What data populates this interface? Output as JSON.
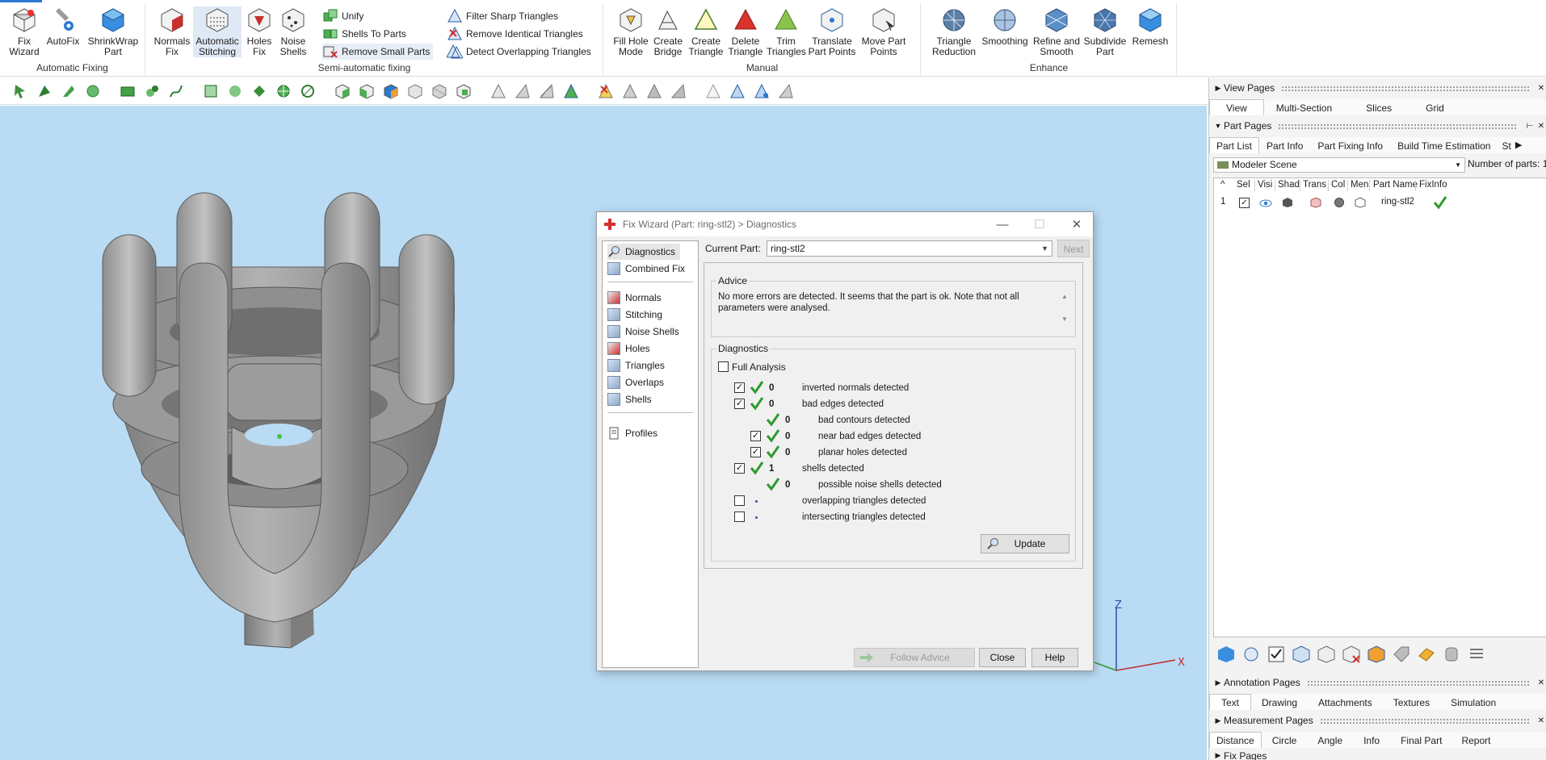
{
  "ribbon": {
    "groups": {
      "automatic": "Automatic Fixing",
      "semi": "Semi-automatic fixing",
      "manual": "Manual",
      "enhance": "Enhance"
    },
    "buttons": {
      "fix_wizard": "Fix Wizard",
      "autofix": "AutoFix",
      "shrinkwrap": "ShrinkWrap Part",
      "normals_fix": "Normals Fix",
      "auto_stitching": "Automatic Stitching",
      "holes_fix": "Holes Fix",
      "noise_shells": "Noise Shells",
      "unify": "Unify",
      "shells_to_parts": "Shells To Parts",
      "remove_small_parts": "Remove Small Parts",
      "filter_sharp": "Filter Sharp Triangles",
      "remove_identical": "Remove Identical Triangles",
      "detect_overlapping": "Detect Overlapping Triangles",
      "fill_hole_mode": "Fill Hole Mode",
      "create_bridge": "Create Bridge",
      "create_triangle": "Create Triangle",
      "delete_triangle": "Delete Triangle",
      "trim_triangles": "Trim Triangles",
      "translate_part_points": "Translate Part Points",
      "move_part_points": "Move Part Points",
      "triangle_reduction": "Triangle Reduction",
      "smoothing": "Smoothing",
      "refine_smooth": "Refine and Smooth",
      "subdivide_part": "Subdivide Part",
      "remesh": "Remesh"
    }
  },
  "axes": {
    "z": "Z",
    "x": "X"
  },
  "dialog": {
    "title": "Fix Wizard (Part: ring-stl2) > Diagnostics",
    "nav": {
      "diagnostics": "Diagnostics",
      "combined_fix": "Combined Fix",
      "normals": "Normals",
      "stitching": "Stitching",
      "noise_shells": "Noise Shells",
      "holes": "Holes",
      "triangles": "Triangles",
      "overlaps": "Overlaps",
      "shells": "Shells",
      "profiles": "Profiles"
    },
    "current_part_label": "Current Part:",
    "current_part_value": "ring-stl2",
    "next_label": "Next",
    "advice_label": "Advice",
    "advice_text": "No more errors are detected. It seems that the part is ok. Note that not all parameters were analysed.",
    "diagnostics_label": "Diagnostics",
    "full_analysis_label": "Full Analysis",
    "rows": [
      {
        "count": "0",
        "text": "inverted normals detected"
      },
      {
        "count": "0",
        "text": "bad edges detected"
      },
      {
        "count": "0",
        "text": "bad contours detected"
      },
      {
        "count": "0",
        "text": "near bad edges detected"
      },
      {
        "count": "0",
        "text": "planar holes detected"
      },
      {
        "count": "1",
        "text": "shells detected"
      },
      {
        "count": "0",
        "text": "possible noise shells detected"
      },
      {
        "count": "",
        "text": "overlapping triangles detected"
      },
      {
        "count": "",
        "text": "intersecting triangles detected"
      }
    ],
    "update_label": "Update",
    "follow_advice_label": "Follow Advice",
    "close_label": "Close",
    "help_label": "Help"
  },
  "right_panel": {
    "view_pages": "View Pages",
    "view_tabs": [
      "View",
      "Multi-Section",
      "Slices",
      "Grid"
    ],
    "part_pages": "Part Pages",
    "part_tabs": [
      "Part List",
      "Part Info",
      "Part Fixing Info",
      "Build Time Estimation",
      "St"
    ],
    "scene_value": "Modeler Scene",
    "num_parts_label": "Number of parts:",
    "num_parts_value": "1",
    "columns": [
      "Sel",
      "Visi",
      "Shad",
      "Trans",
      "Col",
      "Men",
      "Part Name",
      "FixInfo"
    ],
    "row": {
      "index": "1",
      "name": "ring-stl2"
    },
    "annotation_pages": "Annotation Pages",
    "annotation_tabs": [
      "Text",
      "Drawing",
      "Attachments",
      "Textures",
      "Simulation"
    ],
    "measurement_pages": "Measurement Pages",
    "measurement_tabs": [
      "Distance",
      "Circle",
      "Angle",
      "Info",
      "Final Part",
      "Report"
    ],
    "fix_pages": "Fix Pages"
  },
  "colors": {
    "viewport_bg": "#b9dbf4",
    "check_green": "#2f9a2f",
    "accent_blue": "#2b79d0"
  }
}
